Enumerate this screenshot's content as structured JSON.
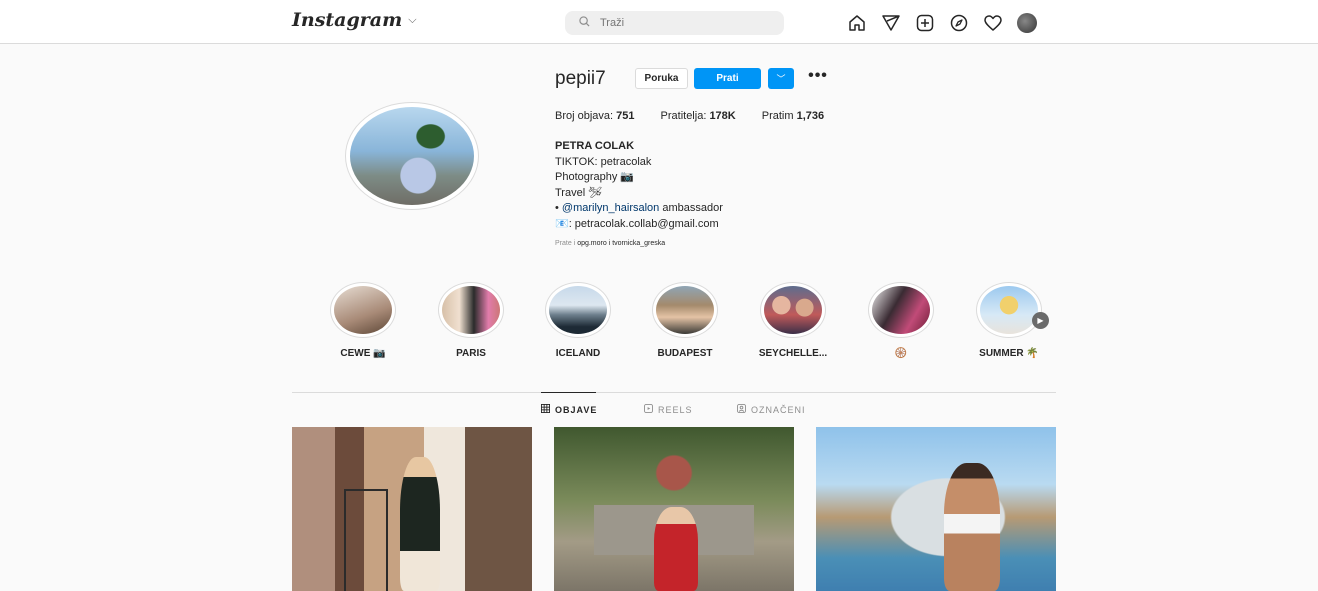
{
  "nav": {
    "logo": "Instagram",
    "logo_chevron": "⌵",
    "search_placeholder": "Traži",
    "icons": [
      "home-icon",
      "direct-icon",
      "new-post-icon",
      "explore-icon",
      "activity-icon",
      "profile-avatar"
    ]
  },
  "profile": {
    "username": "pepii7",
    "message_button": "Poruka",
    "follow_button": "Prati",
    "dropdown_glyph": "﹀",
    "more_glyph": "•••",
    "stats": {
      "posts_label": "Broj objava:",
      "posts_value": "751",
      "followers_label": "Pratitelja:",
      "followers_value": "178K",
      "following_label": "Pratim",
      "following_value": "1,736"
    },
    "bio": {
      "name": "PETRA COLAK",
      "line1": "TIKTOK: petracolak",
      "line2": "Photography 📷",
      "line3": "Travel 🛩",
      "line4_prefix": "• ",
      "line4_mention": "@marilyn_hairsalon",
      "line4_suffix": " ambassador",
      "line5": "📧: petracolak.collab@gmail.com"
    },
    "followed_by": {
      "prefix": "Prate i ",
      "users": "opg.moro i tvornicka_greska"
    }
  },
  "highlights": [
    {
      "label": "CEWE 📷"
    },
    {
      "label": "PARIS"
    },
    {
      "label": "ICELAND"
    },
    {
      "label": "BUDAPEST"
    },
    {
      "label": "SEYCHELLE..."
    },
    {
      "label": "🛞"
    },
    {
      "label": "SUMMER 🌴"
    }
  ],
  "tabs": [
    {
      "label": "OBJAVE",
      "icon": "grid-icon",
      "active": true
    },
    {
      "label": "REELS",
      "icon": "reels-icon",
      "active": false
    },
    {
      "label": "OZNAČENI",
      "icon": "tagged-icon",
      "active": false
    }
  ],
  "colors": {
    "accent": "#0095f6",
    "background": "#fafafa",
    "border": "#dbdbdb"
  }
}
